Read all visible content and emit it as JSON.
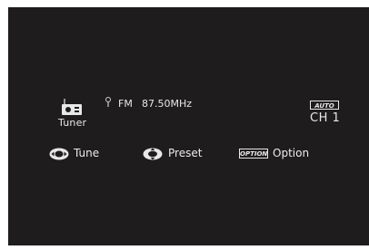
{
  "source": {
    "icon": "radio-icon",
    "label": "Tuner"
  },
  "reception": {
    "antenna_icon": "antenna-icon",
    "band": "FM",
    "frequency": "87.50MHz"
  },
  "mode": {
    "badge": "AUTO",
    "channel": "CH 1"
  },
  "controls": {
    "tune": {
      "icon": "left-right-dial-icon",
      "label": "Tune"
    },
    "preset": {
      "icon": "up-down-dial-icon",
      "label": "Preset"
    },
    "option": {
      "badge": "OPTION",
      "label": "Option"
    }
  },
  "colors": {
    "background": "#1f1c1d",
    "text": "#e8e8e8"
  }
}
